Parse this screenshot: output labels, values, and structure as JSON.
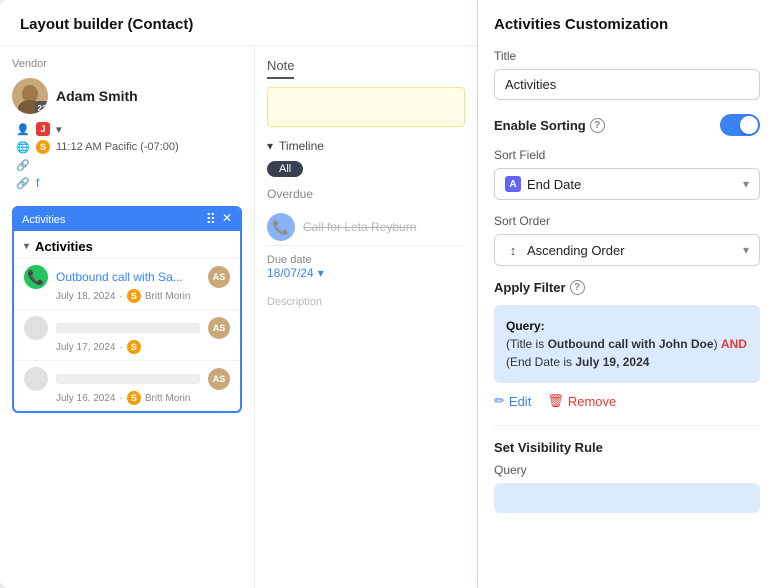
{
  "header": {
    "title": "Layout builder (Contact)"
  },
  "contact": {
    "vendor_label": "Vendor",
    "name": "Adam Smith",
    "avatar_initials": "AS",
    "badge_number": "22",
    "badge_j": "J",
    "time": "11:12 AM Pacific (-07:00)",
    "meta_chevron": "▾"
  },
  "activities_widget": {
    "tab_label": "Activities",
    "header_label": "Activities",
    "items": [
      {
        "title": "Outbound call with Sa...",
        "date": "July 18, 2024",
        "assignee": "Britt Morin",
        "assignee_badge": "S"
      },
      {
        "title": "",
        "date": "July 17, 2024",
        "assignee": "",
        "assignee_badge": "S"
      },
      {
        "title": "",
        "date": "July 16, 2024",
        "assignee": "Britt Morin",
        "assignee_badge": "S"
      }
    ]
  },
  "note": {
    "label": "Note"
  },
  "timeline": {
    "label": "Timeline",
    "all_btn": "All"
  },
  "overdue": {
    "label": "Overdue",
    "call_title": "Call for Leta Reyburn"
  },
  "due_date": {
    "label": "Due date",
    "value": "18/07/24",
    "chevron": "▾"
  },
  "description": {
    "placeholder": "Description"
  },
  "right_panel": {
    "title": "Activities Customization",
    "title_field_label": "Title",
    "title_value": "Activities",
    "enable_sorting_label": "Enable Sorting",
    "sort_field_label": "Sort Field",
    "sort_field_value": "End Date",
    "sort_order_label": "Sort Order",
    "sort_order_value": "Ascending Order",
    "apply_filter_label": "Apply Filter",
    "query": {
      "label": "Query:",
      "text_before": "(Title is ",
      "bold1": "Outbound call with John Doe",
      "and_text": "AND",
      "text_after": " (End Date is ",
      "bold2": "July 19, 2024"
    },
    "edit_btn": "Edit",
    "remove_btn": "Remove",
    "set_visibility_label": "Set Visibility Rule",
    "query_sub_label": "Query"
  },
  "icons": {
    "chevron_down": "▾",
    "chevron_right": "▸",
    "sort": "↕",
    "pencil": "✏",
    "trash": "🗑",
    "phone": "📞",
    "question": "?",
    "move": "⠿",
    "delete": "✕",
    "collapse": "▾"
  },
  "colors": {
    "primary": "#3b82f6",
    "danger": "#e53935",
    "success": "#22c55e",
    "toggle_on": "#3b82f6"
  }
}
